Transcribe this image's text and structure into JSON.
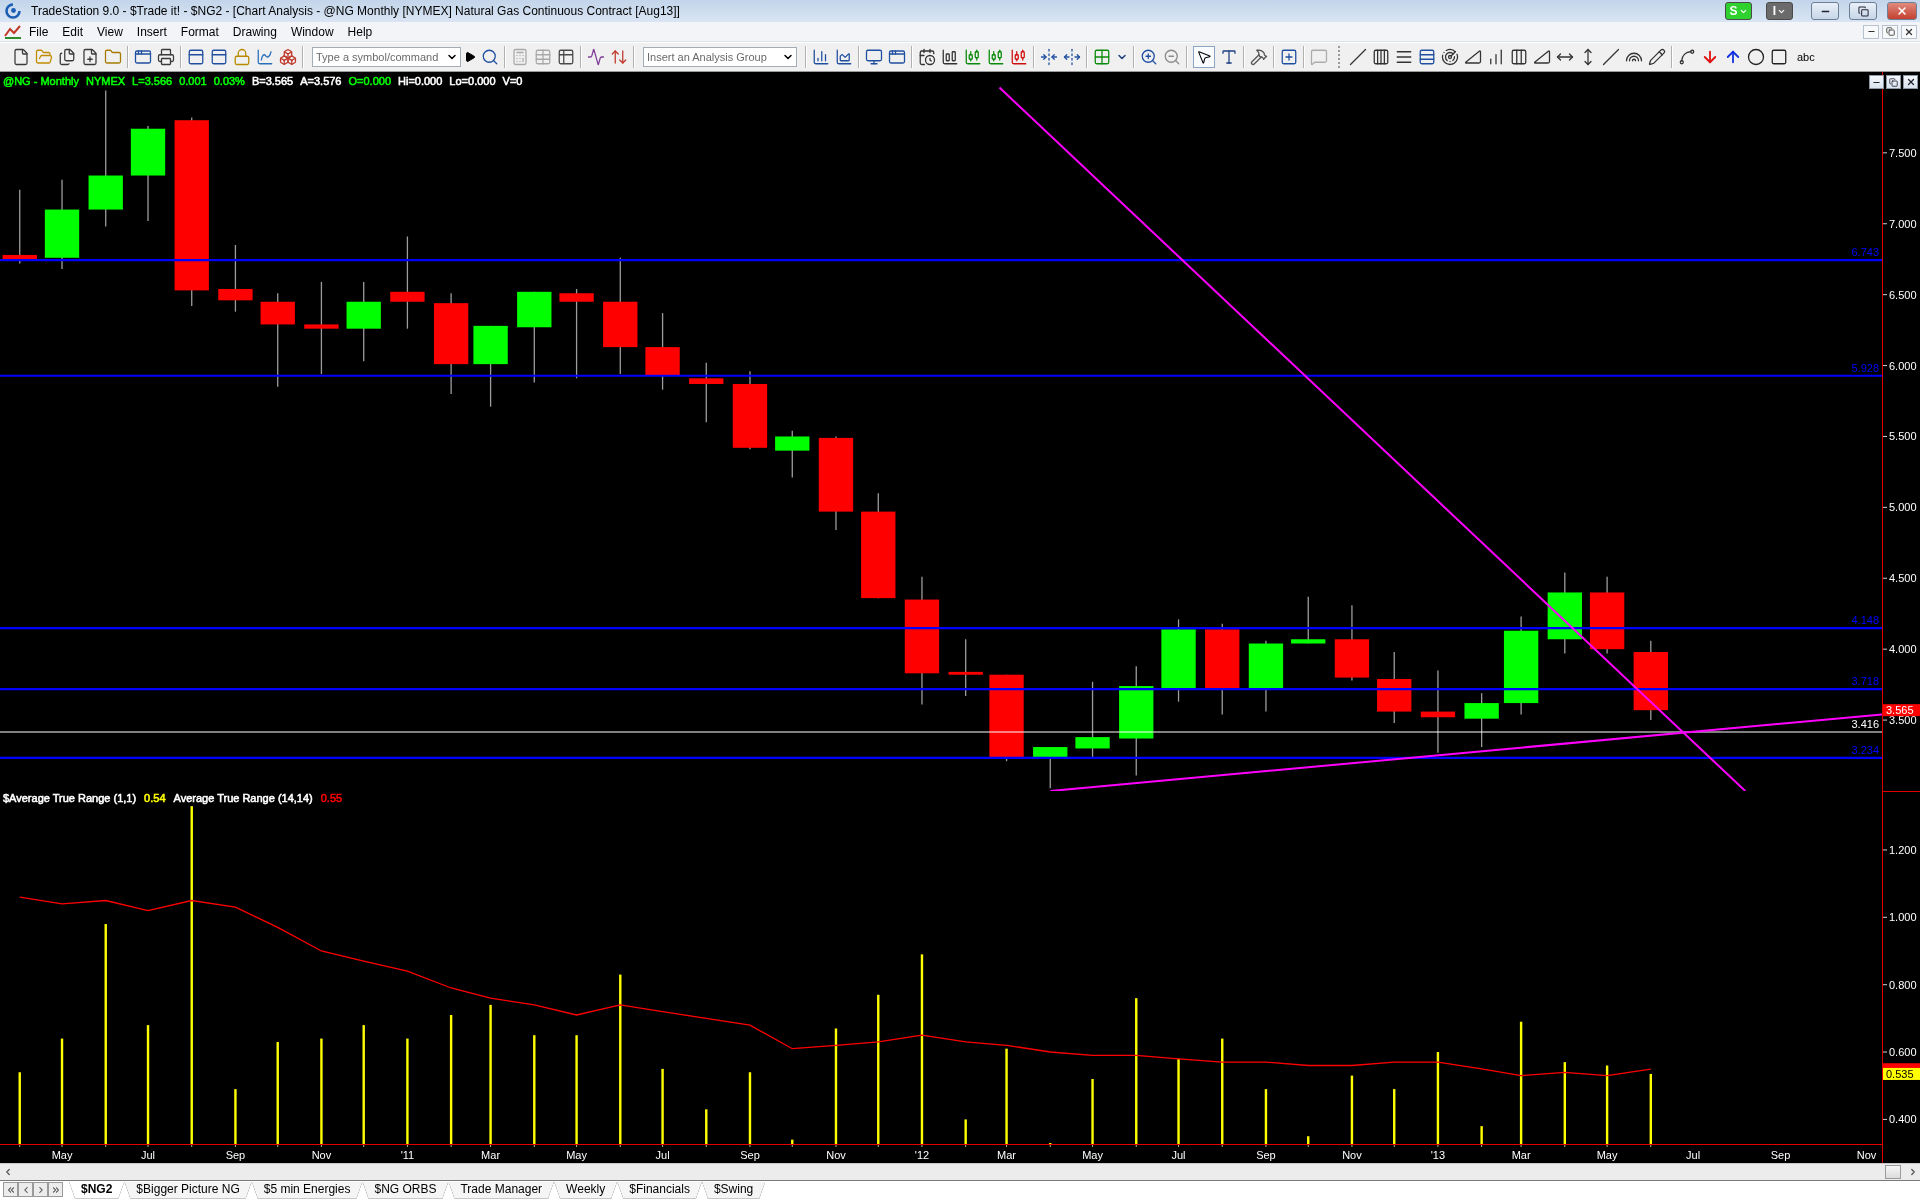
{
  "window": {
    "title": "TradeStation 9.0 - $Trade it! - $NG2 - [Chart Analysis - @NG Monthly [NYMEX] Natural Gas Continuous Contract [Aug13]]",
    "status_buttons": [
      {
        "label": "S",
        "color": "#2fd12f"
      },
      {
        "label": "I",
        "color": "#6b6b6b"
      }
    ]
  },
  "menu": [
    "File",
    "Edit",
    "View",
    "Insert",
    "Format",
    "Drawing",
    "Window",
    "Help"
  ],
  "toolbar": {
    "symbol_box": {
      "placeholder": "Type a symbol/command"
    },
    "analysis_box": {
      "placeholder": "Insert an Analysis Group"
    },
    "pointer_tool": {
      "selected": true
    },
    "text_tool": {
      "label": "abc",
      "selected": false
    }
  },
  "chart": {
    "quote_line": [
      {
        "text": "@NG - Monthly",
        "color": "#00ff00"
      },
      {
        "text": "NYMEX",
        "color": "#00ff00"
      },
      {
        "text": "L=3.566",
        "color": "#00ff00"
      },
      {
        "text": "0.001",
        "color": "#00ff00"
      },
      {
        "text": "0.03%",
        "color": "#00ff00"
      },
      {
        "text": "B=3.565",
        "color": "#ffffff"
      },
      {
        "text": "A=3.576",
        "color": "#ffffff"
      },
      {
        "text": "O=0.000",
        "color": "#00ff00"
      },
      {
        "text": "Hi=0.000",
        "color": "#ffffff"
      },
      {
        "text": "Lo=0.000",
        "color": "#ffffff"
      },
      {
        "text": "V=0",
        "color": "#ffffff"
      }
    ],
    "indicator_legend": [
      {
        "text": "$Average True Range (1,1)",
        "color": "#ffffff"
      },
      {
        "text": "0.54",
        "color": "#ffff00"
      },
      {
        "text": "Average True Range (14,14)",
        "color": "#ffffff"
      },
      {
        "text": "0.55",
        "color": "#ff0000"
      }
    ],
    "chart_data": [
      {
        "type": "candlestick",
        "x": [
          "2010-04-01",
          "2010-05-01",
          "2010-06-01",
          "2010-07-01",
          "2010-08-01",
          "2010-09-01",
          "2010-10-01",
          "2010-11-01",
          "2010-12-01",
          "2011-01-01",
          "2011-02-01",
          "2011-03-01",
          "2011-04-01",
          "2011-05-01",
          "2011-06-01",
          "2011-07-01",
          "2011-08-01",
          "2011-09-01",
          "2011-10-01",
          "2011-11-01",
          "2011-12-01",
          "2012-01-01",
          "2012-02-01",
          "2012-03-01",
          "2012-04-01",
          "2012-05-01",
          "2012-06-01",
          "2012-07-01",
          "2012-08-01",
          "2012-09-01",
          "2012-10-01",
          "2012-11-01",
          "2012-12-01",
          "2013-01-01",
          "2013-02-01",
          "2013-03-01",
          "2013-04-01",
          "2013-05-01",
          "2013-06-01"
        ],
        "ohlc": [
          [
            6.78,
            7.24,
            6.72,
            6.75
          ],
          [
            6.76,
            7.31,
            6.68,
            7.1
          ],
          [
            7.1,
            7.94,
            6.98,
            7.34
          ],
          [
            7.34,
            7.69,
            7.02,
            7.67
          ],
          [
            7.73,
            7.75,
            6.42,
            6.53
          ],
          [
            6.54,
            6.85,
            6.38,
            6.46
          ],
          [
            6.45,
            6.51,
            5.85,
            6.29
          ],
          [
            6.29,
            6.59,
            5.94,
            6.26
          ],
          [
            6.26,
            6.59,
            6.03,
            6.45
          ],
          [
            6.52,
            6.91,
            6.26,
            6.45
          ],
          [
            6.44,
            6.51,
            5.8,
            6.01
          ],
          [
            6.01,
            6.28,
            5.71,
            6.28
          ],
          [
            6.27,
            6.52,
            5.88,
            6.52
          ],
          [
            6.51,
            6.54,
            5.91,
            6.45
          ],
          [
            6.45,
            6.76,
            5.94,
            6.13
          ],
          [
            6.13,
            6.37,
            5.83,
            5.93
          ],
          [
            5.91,
            6.02,
            5.6,
            5.87
          ],
          [
            5.87,
            5.96,
            5.41,
            5.42
          ],
          [
            5.4,
            5.54,
            5.21,
            5.5
          ],
          [
            5.49,
            5.5,
            4.84,
            4.97
          ],
          [
            4.97,
            5.1,
            4.36,
            4.36
          ],
          [
            4.35,
            4.51,
            3.61,
            3.83
          ],
          [
            3.84,
            4.07,
            3.67,
            3.82
          ],
          [
            3.82,
            3.82,
            3.21,
            3.24
          ],
          [
            3.24,
            3.31,
            3.02,
            3.31
          ],
          [
            3.3,
            3.77,
            3.24,
            3.38
          ],
          [
            3.37,
            3.88,
            3.11,
            3.74
          ],
          [
            3.72,
            4.21,
            3.63,
            4.14
          ],
          [
            4.14,
            4.18,
            3.54,
            3.72
          ],
          [
            3.72,
            4.06,
            3.56,
            4.04
          ],
          [
            4.04,
            4.37,
            4.04,
            4.07
          ],
          [
            4.07,
            4.31,
            3.78,
            3.8
          ],
          [
            3.79,
            3.98,
            3.48,
            3.56
          ],
          [
            3.56,
            3.85,
            3.27,
            3.52
          ],
          [
            3.51,
            3.69,
            3.31,
            3.62
          ],
          [
            3.62,
            4.23,
            3.54,
            4.13
          ],
          [
            4.07,
            4.54,
            3.97,
            4.4
          ],
          [
            4.4,
            4.51,
            3.97,
            4.0
          ],
          [
            3.98,
            4.06,
            3.5,
            3.57
          ]
        ],
        "series": [
          {
            "type": "line",
            "color": "#ff00ff",
            "x": [
              "2012-02-25",
              "2013-08-07"
            ],
            "values": [
              7.96,
              3.0
            ]
          },
          {
            "type": "line",
            "color": "#ff00ff",
            "x": [
              "2012-04-01",
              "2013-11-12"
            ],
            "values": [
              3.0,
              3.54
            ]
          }
        ],
        "ref_lines": [
          {
            "axis": "y",
            "value": 6.743,
            "label": "6.743",
            "color": "#0000ff"
          },
          {
            "axis": "y",
            "value": 5.928,
            "label": "5.928",
            "color": "#0000ff"
          },
          {
            "axis": "y",
            "value": 4.148,
            "label": "4.148",
            "color": "#0000ff"
          },
          {
            "axis": "y",
            "value": 3.718,
            "label": "3.718",
            "color": "#0000ff"
          },
          {
            "axis": "y",
            "value": 3.416,
            "label": "3.416",
            "color": "#ffffff"
          },
          {
            "axis": "y",
            "value": 3.234,
            "label": "3.234",
            "color": "#0000ff"
          }
        ],
        "annotations": [
          "3.565"
        ],
        "xlim": [
          "2010-03-18",
          "2013-11-12"
        ],
        "ylim": [
          3.0,
          8.07
        ],
        "yticks": [
          {
            "value": 3.5,
            "label": "3.500"
          },
          {
            "value": 4.0,
            "label": "4.000"
          },
          {
            "value": 4.5,
            "label": "4.500"
          },
          {
            "value": 5.0,
            "label": "5.000"
          },
          {
            "value": 5.5,
            "label": "5.500"
          },
          {
            "value": 6.0,
            "label": "6.000"
          },
          {
            "value": 6.5,
            "label": "6.500"
          },
          {
            "value": 7.0,
            "label": "7.000"
          },
          {
            "value": 7.5,
            "label": "7.500"
          }
        ],
        "tick_labels": "y"
      },
      {
        "type": "bar",
        "x": [
          "2010-04-01",
          "2010-05-01",
          "2010-06-01",
          "2010-07-01",
          "2010-08-01",
          "2010-09-01",
          "2010-10-01",
          "2010-11-01",
          "2010-12-01",
          "2011-01-01",
          "2011-02-01",
          "2011-03-01",
          "2011-04-01",
          "2011-05-01",
          "2011-06-01",
          "2011-07-01",
          "2011-08-01",
          "2011-09-01",
          "2011-10-01",
          "2011-11-01",
          "2011-12-01",
          "2012-01-01",
          "2012-02-01",
          "2012-03-01",
          "2012-04-01",
          "2012-05-01",
          "2012-06-01",
          "2012-07-01",
          "2012-08-01",
          "2012-09-01",
          "2012-10-01",
          "2012-11-01",
          "2012-12-01",
          "2013-01-01",
          "2013-02-01",
          "2013-03-01",
          "2013-04-01",
          "2013-05-01",
          "2013-06-01"
        ],
        "series": [
          {
            "type": "bar",
            "color": "#ffff00",
            "values": [
              0.54,
              0.64,
              0.98,
              0.68,
              1.33,
              0.49,
              0.63,
              0.64,
              0.68,
              0.64,
              0.71,
              0.74,
              0.65,
              0.65,
              0.83,
              0.55,
              0.43,
              0.54,
              0.34,
              0.67,
              0.77,
              0.89,
              0.4,
              0.61,
              0.33,
              0.52,
              0.76,
              0.58,
              0.64,
              0.49,
              0.35,
              0.53,
              0.49,
              0.6,
              0.38,
              0.69,
              0.57,
              0.56,
              0.535
            ]
          },
          {
            "type": "line",
            "color": "#ff0000",
            "values": [
              1.06,
              1.04,
              1.05,
              1.02,
              1.05,
              1.03,
              0.97,
              0.9,
              0.87,
              0.84,
              0.79,
              0.76,
              0.74,
              0.71,
              0.74,
              0.72,
              0.7,
              0.68,
              0.61,
              0.62,
              0.63,
              0.65,
              0.63,
              0.62,
              0.6,
              0.59,
              0.59,
              0.58,
              0.57,
              0.57,
              0.56,
              0.56,
              0.57,
              0.57,
              0.55,
              0.53,
              0.54,
              0.53,
              0.549
            ]
          }
        ],
        "annotations": [
          "0.535"
        ],
        "xlim": [
          "2010-03-18",
          "2013-11-12"
        ],
        "ylim": [
          0.327,
          1.375
        ],
        "yticks": [
          {
            "value": 0.4,
            "label": "0.400"
          },
          {
            "value": 0.6,
            "label": "0.600"
          },
          {
            "value": 0.8,
            "label": "0.800"
          },
          {
            "value": 1.0,
            "label": "1.000"
          },
          {
            "value": 1.2,
            "label": "1.200"
          }
        ],
        "xticks": [
          {
            "value": "2010-05-01",
            "label": "May"
          },
          {
            "value": "2010-07-01",
            "label": "Jul"
          },
          {
            "value": "2010-09-01",
            "label": "Sep"
          },
          {
            "value": "2010-11-01",
            "label": "Nov"
          },
          {
            "value": "2011-01-01",
            "label": "'11"
          },
          {
            "value": "2011-03-01",
            "label": "Mar"
          },
          {
            "value": "2011-05-01",
            "label": "May"
          },
          {
            "value": "2011-07-01",
            "label": "Jul"
          },
          {
            "value": "2011-09-01",
            "label": "Sep"
          },
          {
            "value": "2011-11-01",
            "label": "Nov"
          },
          {
            "value": "2012-01-01",
            "label": "'12"
          },
          {
            "value": "2012-03-01",
            "label": "Mar"
          },
          {
            "value": "2012-05-01",
            "label": "May"
          },
          {
            "value": "2012-07-01",
            "label": "Jul"
          },
          {
            "value": "2012-09-01",
            "label": "Sep"
          },
          {
            "value": "2012-11-01",
            "label": "Nov"
          },
          {
            "value": "2013-01-01",
            "label": "'13"
          },
          {
            "value": "2013-03-01",
            "label": "Mar"
          },
          {
            "value": "2013-05-01",
            "label": "May"
          },
          {
            "value": "2013-07-01",
            "label": "Jul"
          },
          {
            "value": "2013-09-01",
            "label": "Sep"
          },
          {
            "value": "2013-11-01",
            "label": "Nov"
          }
        ]
      }
    ]
  },
  "tabs": [
    {
      "label": "$NG2",
      "selected": true
    },
    {
      "label": "$Bigger Picture NG",
      "selected": false
    },
    {
      "label": "$5 min Energies",
      "selected": false
    },
    {
      "label": "$NG ORBS",
      "selected": false
    },
    {
      "label": "Trade Manager",
      "selected": false
    },
    {
      "label": "Weekly",
      "selected": false
    },
    {
      "label": "$Financials",
      "selected": false
    },
    {
      "label": "$Swing",
      "selected": false
    }
  ]
}
